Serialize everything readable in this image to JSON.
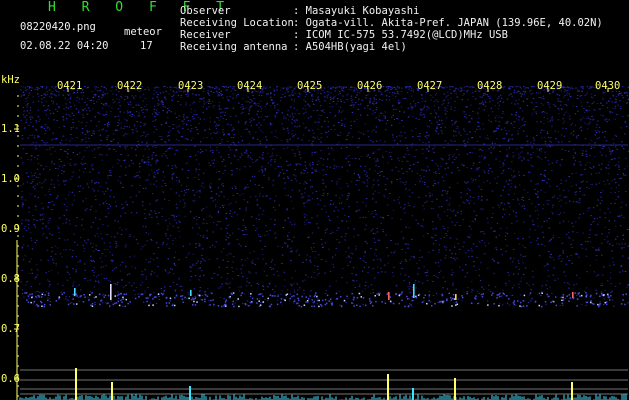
{
  "header": {
    "title": "H R O F F T",
    "filename": "08220420.png",
    "meteor_label": "meteor",
    "datetime": "02.08.22 04:20",
    "meteor_count": "17",
    "info": [
      {
        "label": "Observer",
        "value": ": Masayuki Kobayashi"
      },
      {
        "label": "Receiving Location",
        "value": ": Ogata-vill. Akita-Pref. JAPAN (139.96E, 40.02N)"
      },
      {
        "label": "Receiver",
        "value": ": ICOM IC-575 53.7492(@LCD)MHz USB"
      },
      {
        "label": "Receiving antenna",
        "value": ": A504HB(yagi 4el)"
      }
    ]
  },
  "spectrogram": {
    "unit": "kHz",
    "x_ticks": [
      "0421",
      "0422",
      "0423",
      "0424",
      "0425",
      "0426",
      "0427",
      "0428",
      "0429",
      "0430"
    ],
    "y_ticks": [
      "1.1",
      "1.0",
      "0.9",
      "0.8",
      "0.7",
      "0.6"
    ],
    "colors": {
      "background": "#000000",
      "noise": "#2a2aa8",
      "text_yellow": "#ffff66",
      "title_green": "#2ee02e",
      "cyan": "#40e0ff"
    }
  }
}
